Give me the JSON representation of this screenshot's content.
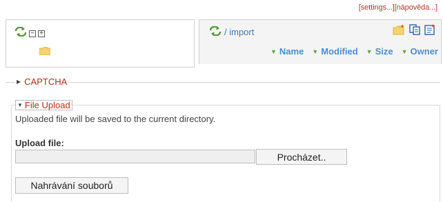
{
  "toplinks": {
    "settings": "[settings...]",
    "help": "[nápověda...]"
  },
  "tree": {
    "collapse_all": "−",
    "expand_all": "+"
  },
  "files": {
    "path": "/ import",
    "columns": [
      "Name",
      "Modified",
      "Size",
      "Owner"
    ]
  },
  "captcha": {
    "label": "CAPTCHA"
  },
  "upload": {
    "legend": "File Upload",
    "info": "Uploaded file will be saved to the current directory.",
    "file_label": "Upload file:",
    "browse": "Procházet..",
    "submit": "Nahrávání souborů"
  },
  "icons": {
    "refresh": "refresh-icon",
    "folder": "folder-icon",
    "new_folder": "new-folder-icon",
    "copy": "copy-icon",
    "paste": "paste-icon"
  },
  "colors": {
    "link_red": "#b32c16",
    "link_blue": "#3a77c0",
    "header_blue": "#4a8ed0",
    "sort_green": "#5aa838"
  }
}
